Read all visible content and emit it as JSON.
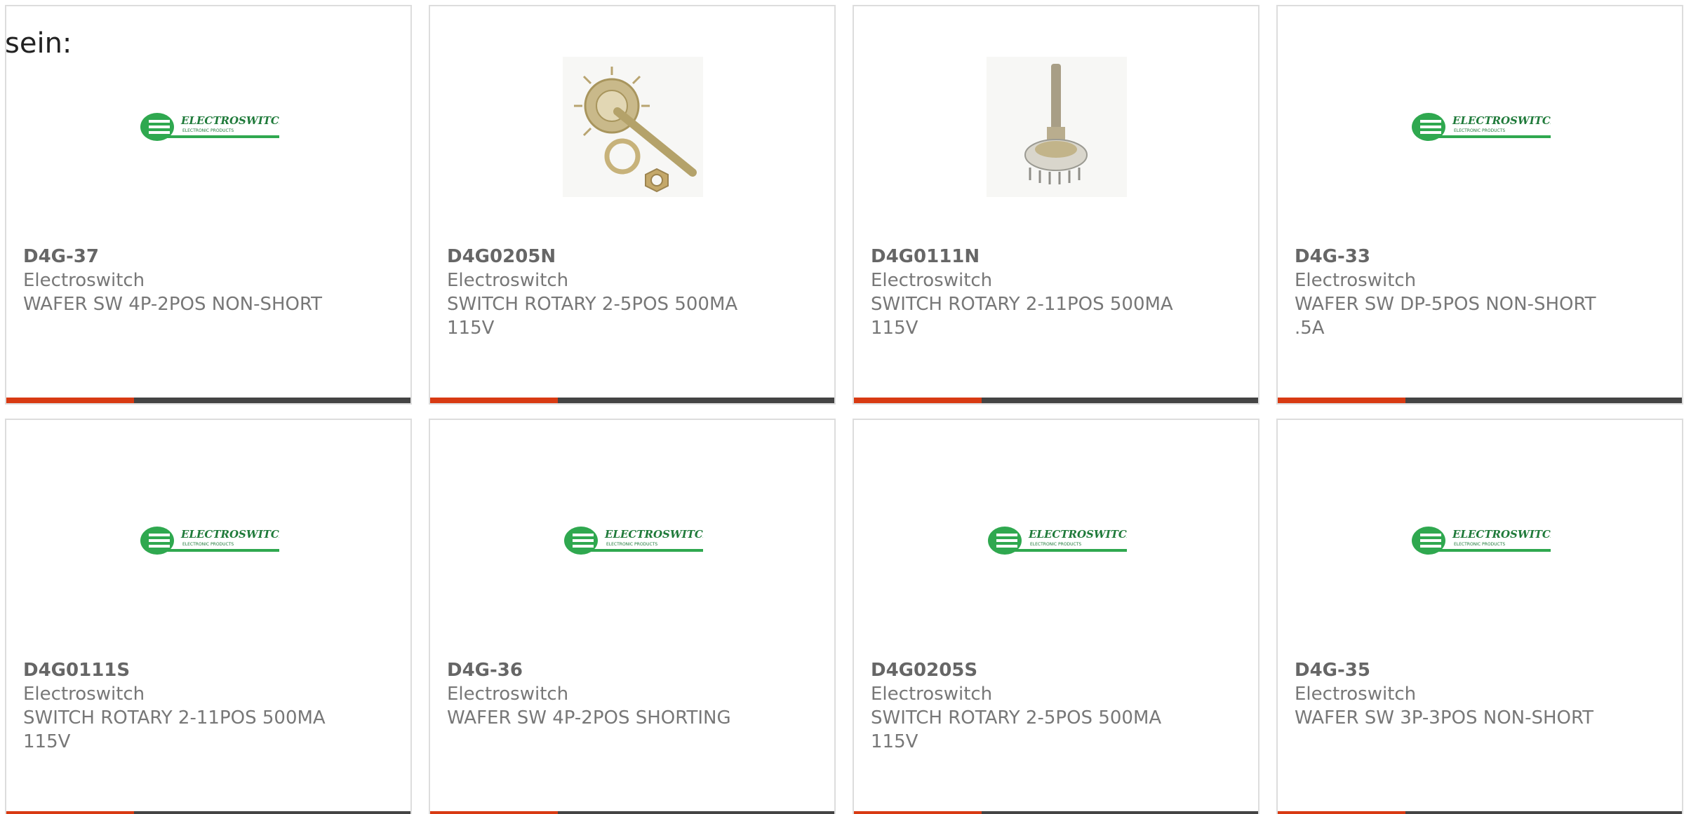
{
  "intro_text": "sein:",
  "colors": {
    "accent": "#d83a12",
    "bar": "#444444",
    "border": "#dddddd",
    "logo_green": "#2fa84f",
    "text": "#777777"
  },
  "products": [
    {
      "part_number": "D4G-37",
      "manufacturer": "Electroswitch",
      "description": "WAFER SW 4P-2POS NON-SHORT",
      "image": "electroswitch-logo",
      "logo_text": "ELECTROSWITCH",
      "logo_subtext": "ELECTRONIC PRODUCTS"
    },
    {
      "part_number": "D4G0205N",
      "manufacturer": "Electroswitch",
      "description": "SWITCH ROTARY 2-5POS 500MA 115V",
      "image": "rotary-switch-with-nut-photo"
    },
    {
      "part_number": "D4G0111N",
      "manufacturer": "Electroswitch",
      "description": "SWITCH ROTARY 2-11POS 500MA 115V",
      "image": "rotary-switch-upright-photo"
    },
    {
      "part_number": "D4G-33",
      "manufacturer": "Electroswitch",
      "description": "WAFER SW DP-5POS NON-SHORT .5A",
      "image": "electroswitch-logo",
      "logo_text": "ELECTROSWITCH",
      "logo_subtext": "ELECTRONIC PRODUCTS"
    },
    {
      "part_number": "D4G0111S",
      "manufacturer": "Electroswitch",
      "description": "SWITCH ROTARY 2-11POS 500MA 115V",
      "image": "electroswitch-logo",
      "logo_text": "ELECTROSWITCH",
      "logo_subtext": "ELECTRONIC PRODUCTS"
    },
    {
      "part_number": "D4G-36",
      "manufacturer": "Electroswitch",
      "description": "WAFER SW 4P-2POS SHORTING",
      "image": "electroswitch-logo",
      "logo_text": "ELECTROSWITCH",
      "logo_subtext": "ELECTRONIC PRODUCTS"
    },
    {
      "part_number": "D4G0205S",
      "manufacturer": "Electroswitch",
      "description": "SWITCH ROTARY 2-5POS 500MA 115V",
      "image": "electroswitch-logo",
      "logo_text": "ELECTROSWITCH",
      "logo_subtext": "ELECTRONIC PRODUCTS"
    },
    {
      "part_number": "D4G-35",
      "manufacturer": "Electroswitch",
      "description": "WAFER SW 3P-3POS NON-SHORT",
      "image": "electroswitch-logo",
      "logo_text": "ELECTROSWITCH",
      "logo_subtext": "ELECTRONIC PRODUCTS"
    }
  ]
}
